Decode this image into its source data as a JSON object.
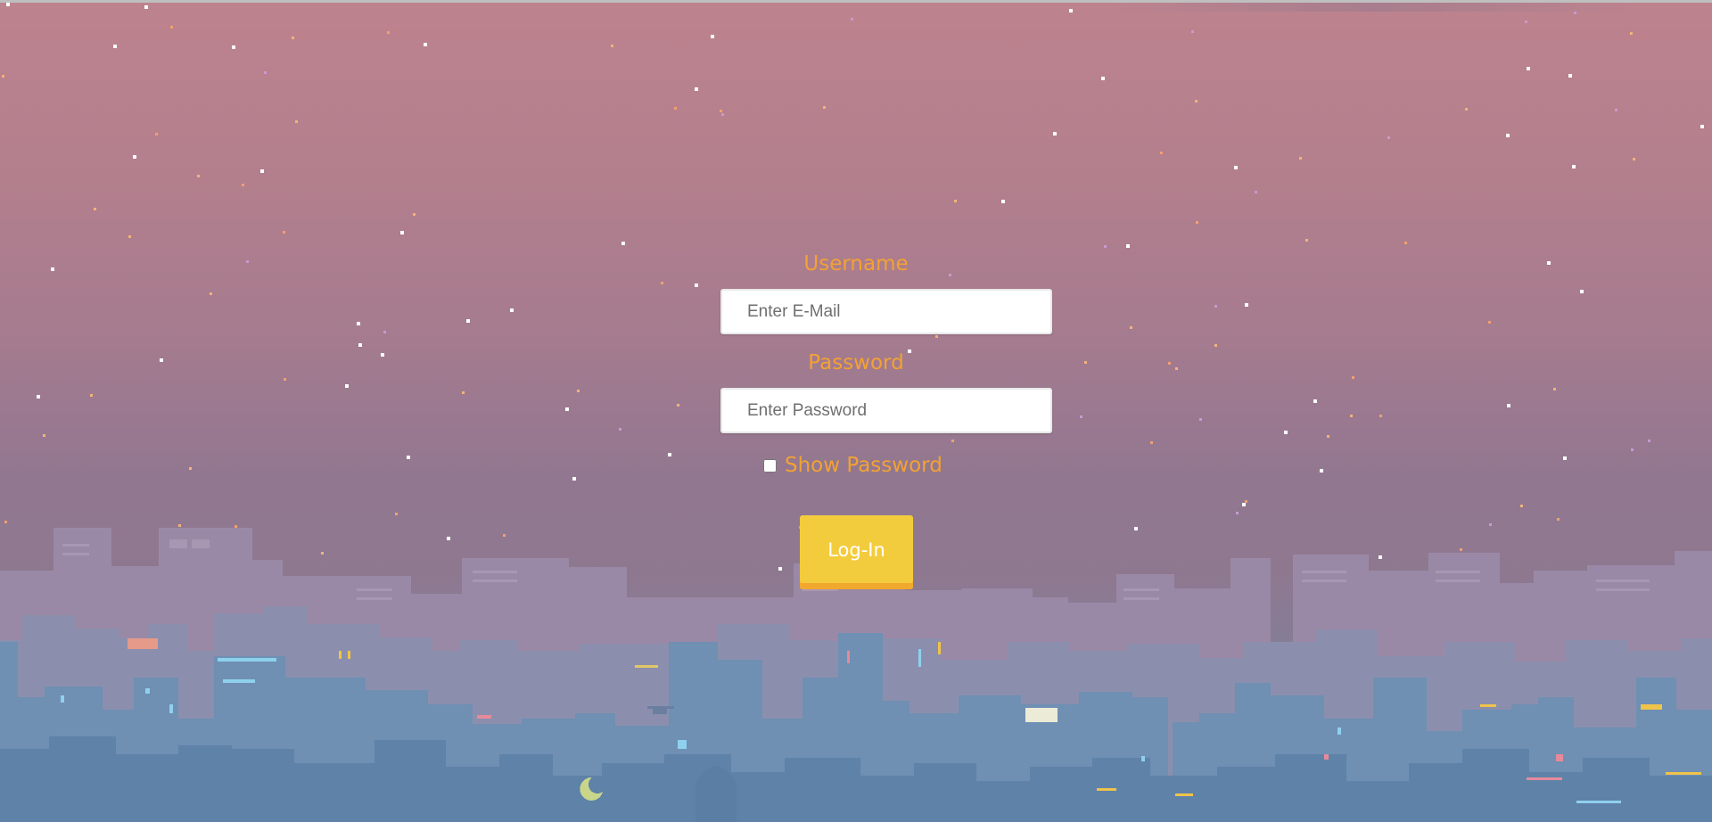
{
  "login_form": {
    "username_label": "Username",
    "username_placeholder": "Enter E-Mail",
    "password_label": "Password",
    "password_placeholder": "Enter Password",
    "show_password_label": "Show Password",
    "show_password_checked": false,
    "login_button_label": "Log-In"
  },
  "colors": {
    "label_orange": "#f2a233",
    "button_yellow": "#f3cc3d",
    "button_shadow": "#f2a82e",
    "sky_top": "#bd838e",
    "sky_bottom": "#8e7890",
    "city_back": "#9a8aa6",
    "city_front": "#6f8fb3"
  },
  "background": {
    "scene": "pixel-art-city-skyline-at-dusk"
  }
}
